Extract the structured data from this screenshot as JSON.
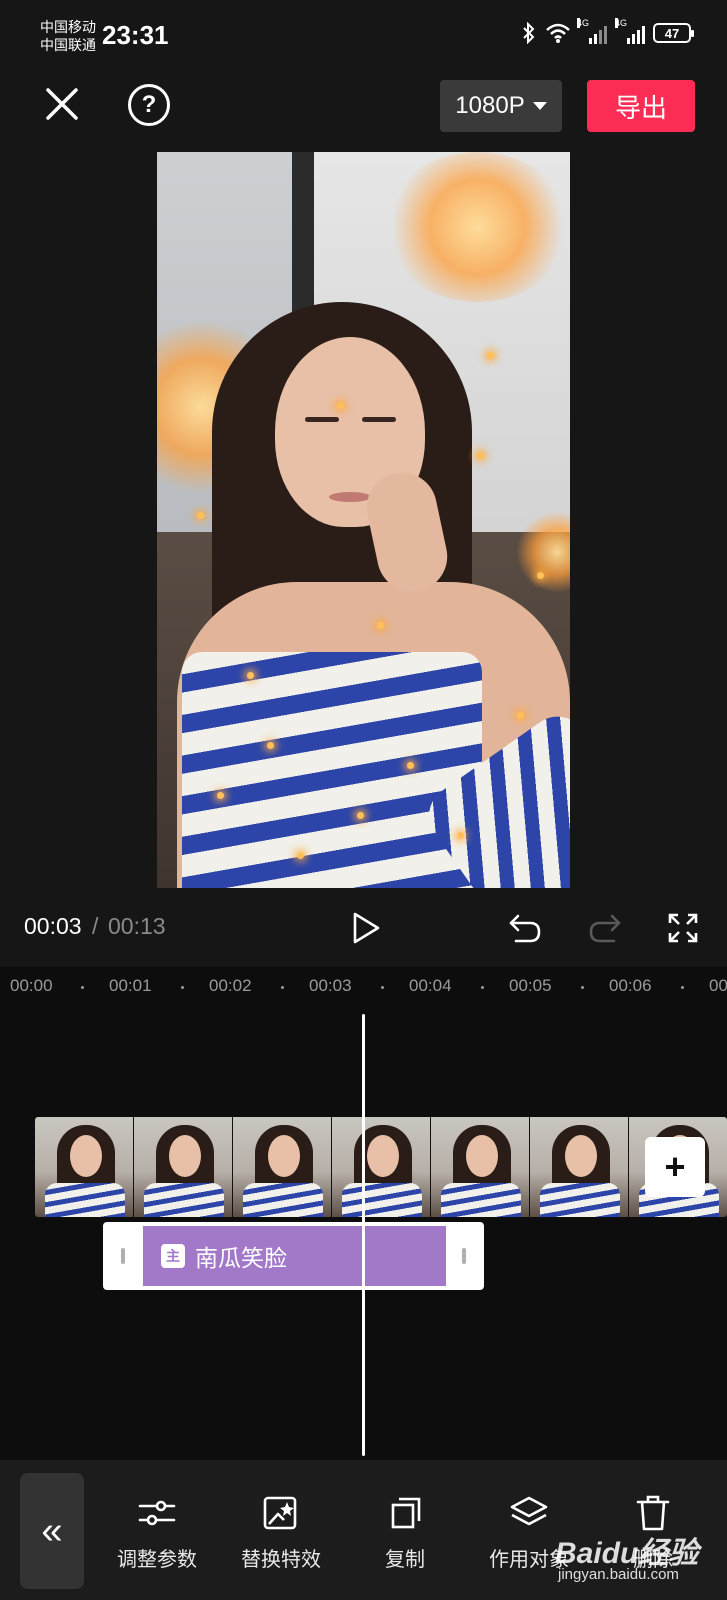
{
  "status_bar": {
    "carrier_1": "中国移动",
    "carrier_2": "中国联通",
    "time": "23:31",
    "signal_tag_1": "4G",
    "signal_tag_2": "4G",
    "battery": "47"
  },
  "toolbar": {
    "close_icon": "close-icon",
    "help_label": "?",
    "resolution": "1080P",
    "export_label": "导出",
    "accent_color": "#fd2c55"
  },
  "playback": {
    "current_time": "00:03",
    "separator": "/",
    "total_time": "00:13"
  },
  "timeline": {
    "ruler": [
      "00:00",
      "00:01",
      "00:02",
      "00:03",
      "00:04",
      "00:05",
      "00:06",
      "00"
    ],
    "add_clip_label": "+",
    "effect_track": {
      "badge": "主",
      "label": "南瓜笑脸",
      "color": "#a279c9"
    }
  },
  "bottom_bar": {
    "back_label": "«",
    "tools": [
      {
        "label": "调整参数",
        "icon": "sliders-icon"
      },
      {
        "label": "替换特效",
        "icon": "replace-effect-icon"
      },
      {
        "label": "复制",
        "icon": "copy-icon"
      },
      {
        "label": "作用对象",
        "icon": "layers-icon"
      },
      {
        "label": "删除",
        "icon": "delete-icon"
      }
    ],
    "watermark": "Baidu经验",
    "watermark_sub": "jingyan.baidu.com"
  }
}
